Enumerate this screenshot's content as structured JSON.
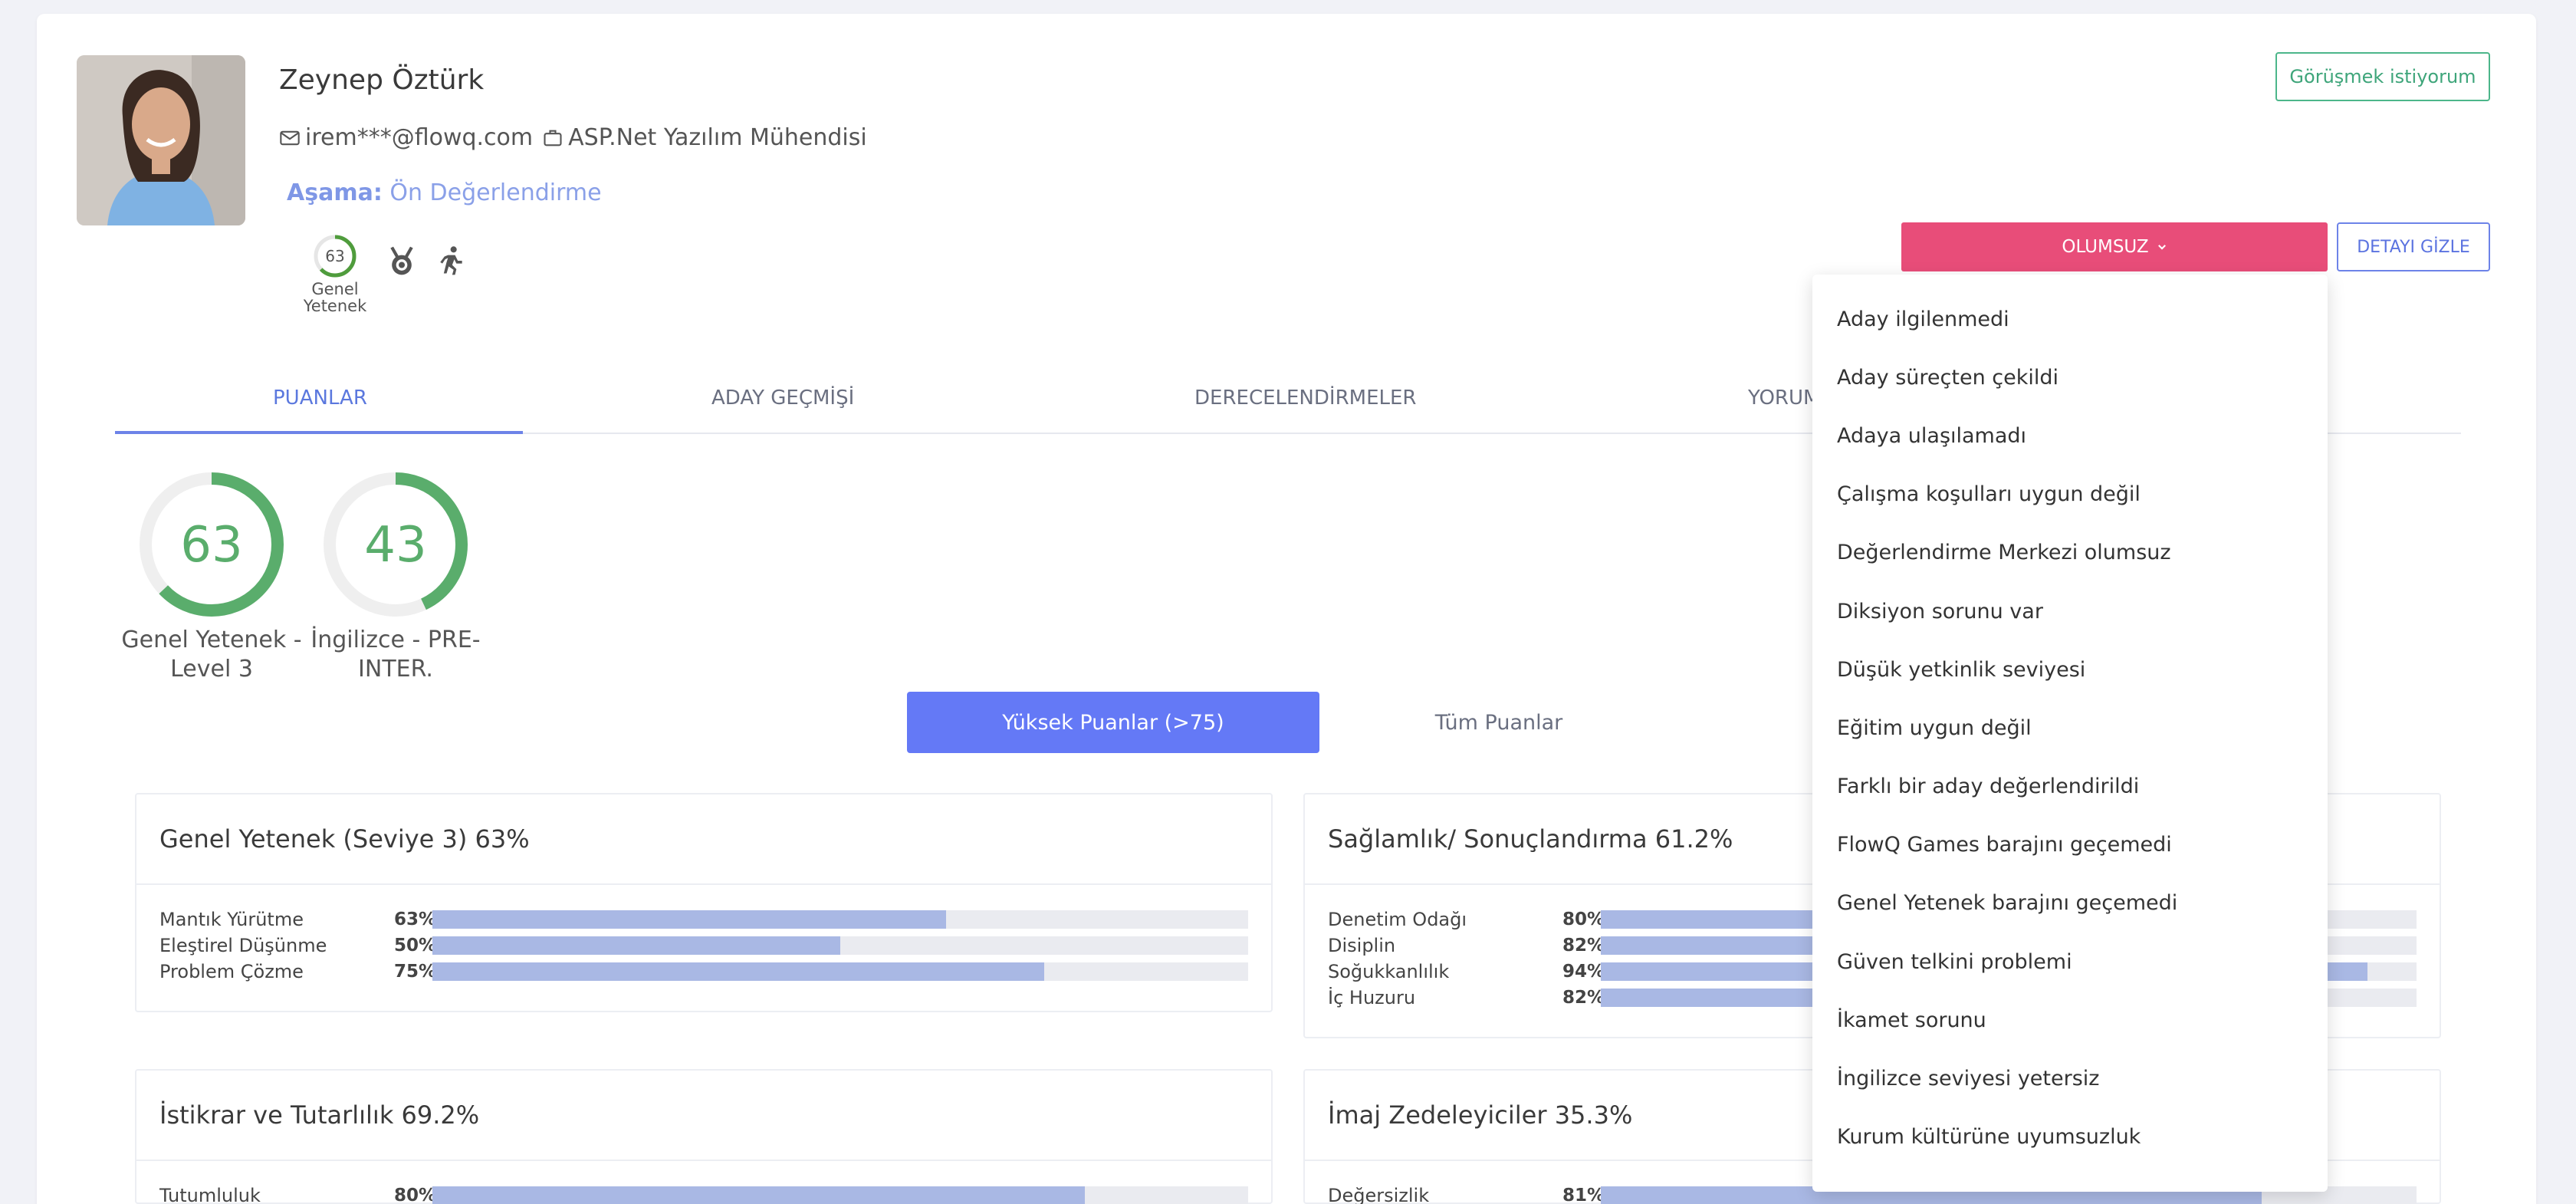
{
  "candidate": {
    "name": "Zeynep Öztürk",
    "email": "irem***@flowq.com",
    "position": "ASP.Net Yazılım Mühendisi",
    "stage_label": "Aşama:",
    "stage_value": "Ön Değerlendirme",
    "badge_score": 63,
    "badge_caption_line1": "Genel",
    "badge_caption_line2": "Yetenek"
  },
  "actions": {
    "meet_label": "Görüşmek istiyorum",
    "negative_label": "OLUMSUZ",
    "detail_label": "DETAYI GİZLE"
  },
  "tabs": [
    {
      "label": "PUANLAR",
      "active": true
    },
    {
      "label": "ADAY GEÇMİŞİ",
      "active": false
    },
    {
      "label": "DERECELENDİRMELER",
      "active": false
    },
    {
      "label": "YORUM",
      "active": false
    }
  ],
  "score_rings": [
    {
      "value": 63,
      "caption_line1": "Genel Yetenek -",
      "caption_line2": "Level 3"
    },
    {
      "value": 43,
      "caption_line1": "İngilizce - PRE-",
      "caption_line2": "INTER."
    }
  ],
  "filters": {
    "high_label": "Yüksek Puanlar (>75)",
    "all_label": "Tüm Puanlar"
  },
  "score_cards": [
    {
      "title": "Genel Yetenek (Seviye 3) 63%",
      "rows": [
        {
          "name": "Mantık Yürütme",
          "percent": "63%",
          "value": 63
        },
        {
          "name": "Eleştirel Düşünme",
          "percent": "50%",
          "value": 50
        },
        {
          "name": "Problem Çözme",
          "percent": "75%",
          "value": 75
        }
      ]
    },
    {
      "title": "Sağlamlık/ Sonuçlandırma 61.2%",
      "rows": [
        {
          "name": "Denetim Odağı",
          "percent": "80%",
          "value": 80
        },
        {
          "name": "Disiplin",
          "percent": "82%",
          "value": 82
        },
        {
          "name": "Soğukkanlılık",
          "percent": "94%",
          "value": 94
        },
        {
          "name": "İç Huzuru",
          "percent": "82%",
          "value": 82
        }
      ]
    },
    {
      "title": "İstikrar ve Tutarlılık 69.2%",
      "rows": [
        {
          "name": "Tutumluluk",
          "percent": "80%",
          "value": 80
        }
      ]
    },
    {
      "title": "İmaj Zedeleyiciler 35.3%",
      "rows": [
        {
          "name": "Değersizlik",
          "percent": "81%",
          "value": 81
        }
      ]
    }
  ],
  "dropdown_items": [
    "Aday ilgilenmedi",
    "Aday süreçten çekildi",
    "Adaya ulaşılamadı",
    "Çalışma koşulları uygun değil",
    "Değerlendirme Merkezi olumsuz",
    "Diksiyon sorunu var",
    "Düşük yetkinlik seviyesi",
    "Eğitim uygun değil",
    "Farklı bir aday değerlendirildi",
    "FlowQ Games barajını geçemedi",
    "Genel Yetenek barajını geçemedi",
    "Güven telkini problemi",
    "İkamet sorunu",
    "İngilizce seviyesi yetersiz",
    "Kurum kültürüne uyumsuzluk"
  ],
  "colors": {
    "accent": "#6479f6",
    "negative": "#e84d79",
    "success": "#4cb68a",
    "bar_fill": "#a9b8e4",
    "ring": "#5aad6c"
  }
}
